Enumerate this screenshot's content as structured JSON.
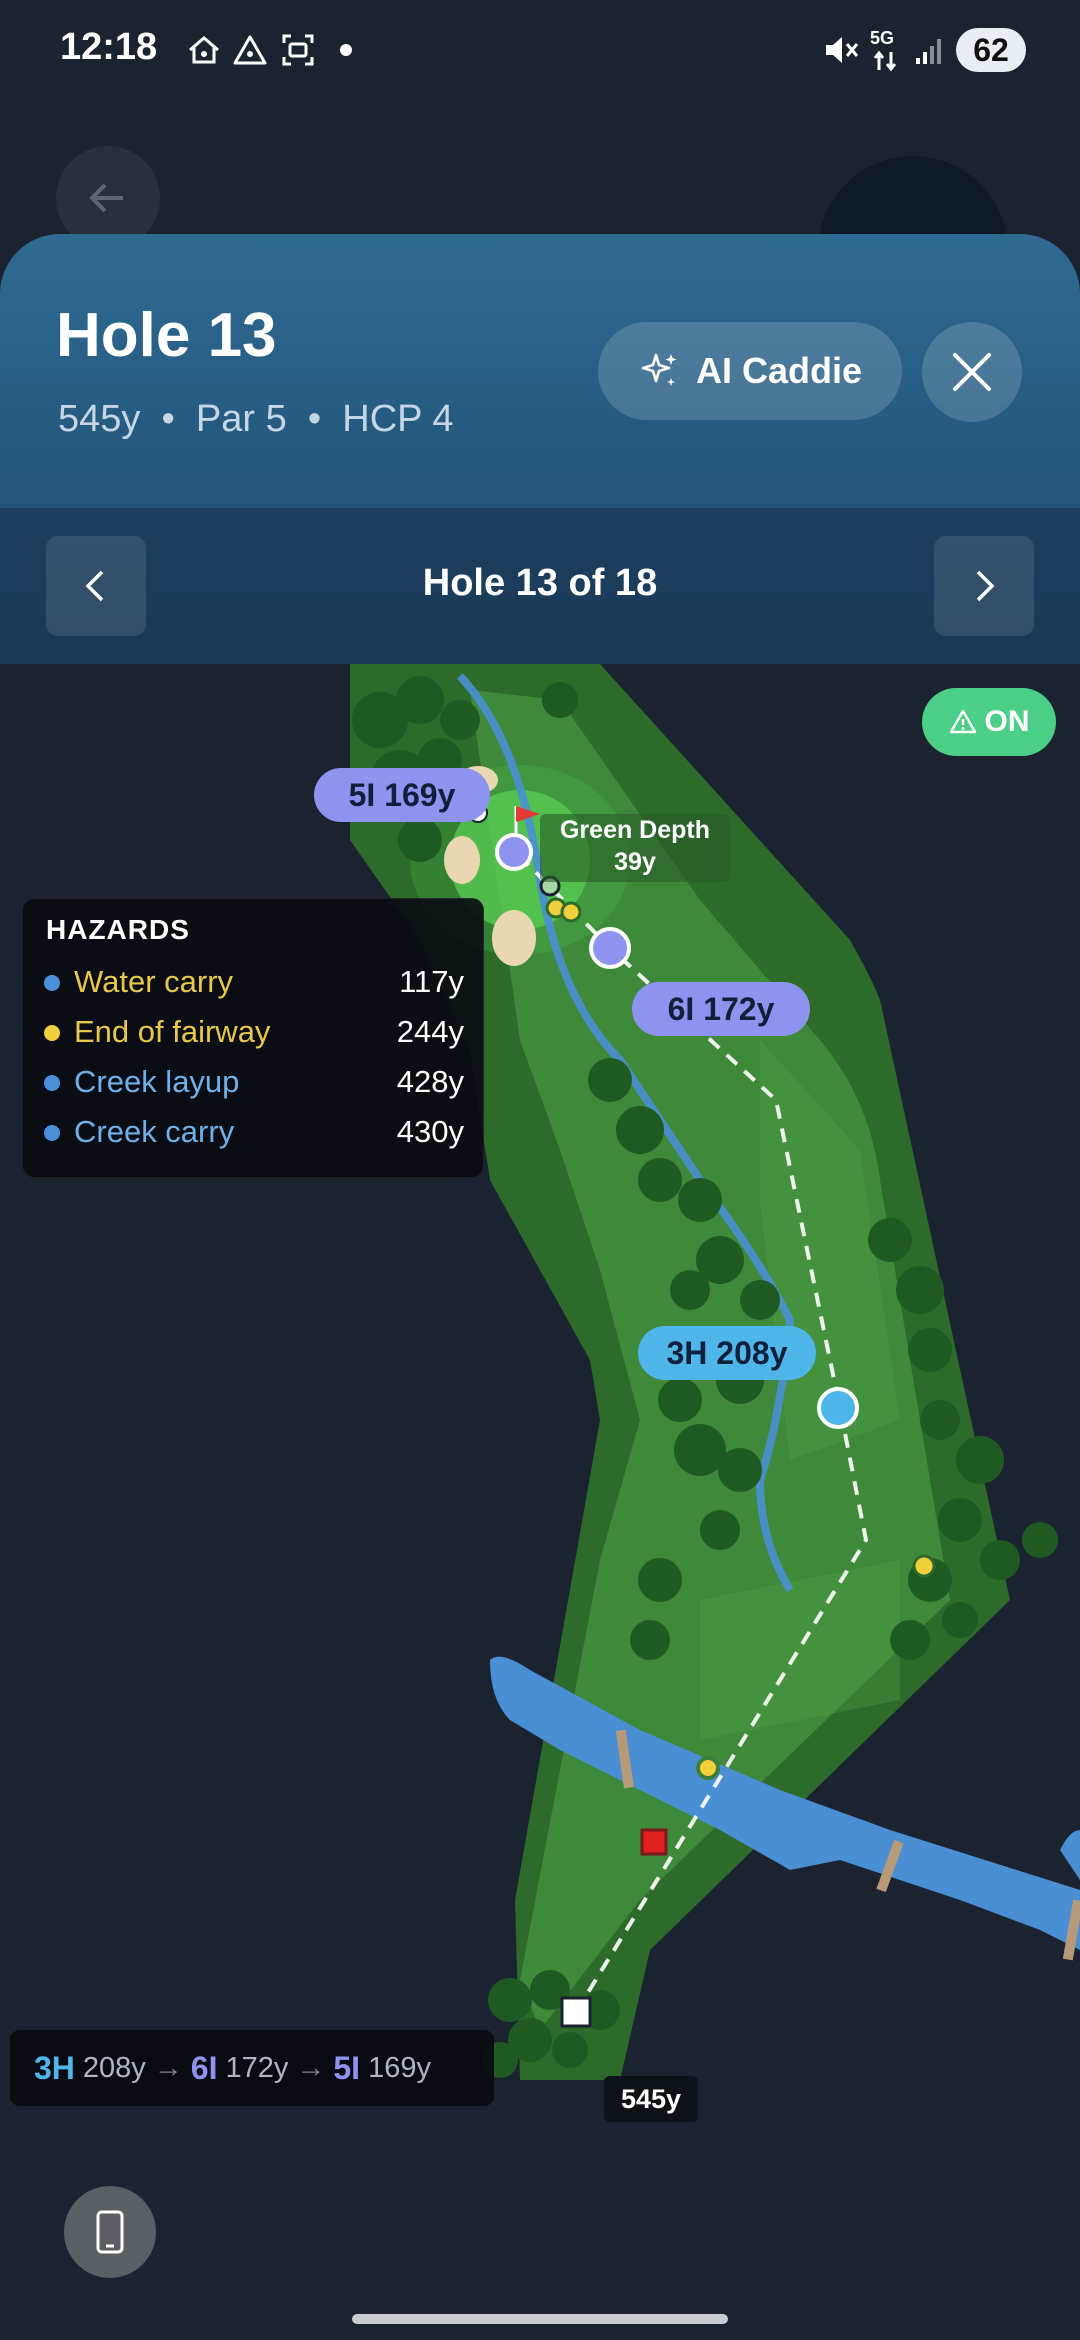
{
  "status_bar": {
    "time": "12:18",
    "network": "5G",
    "battery": "62"
  },
  "header": {
    "title": "Hole 13",
    "subtitle": "545y  •  Par 5  •  HCP 4",
    "ai_caddie_label": "AI Caddie"
  },
  "nav": {
    "title": "Hole 13 of 18"
  },
  "map": {
    "toggle_label": "ON",
    "green_depth_label": "Green Depth",
    "green_depth_value": "39y",
    "club_labels": {
      "five_iron": "5I 169y",
      "six_iron": "6I 172y",
      "three_hybrid": "3H 208y"
    },
    "total_distance": "545y",
    "colors": {
      "water": "#4a8fd4",
      "fairway": "#3f8a3a",
      "rough": "#2d6b2b",
      "shot_5i": "#8f93f0",
      "shot_6i": "#8f93f0",
      "shot_3h": "#4fb6ea"
    }
  },
  "hazards": {
    "title": "HAZARDS",
    "items": [
      {
        "label": "Water carry",
        "distance": "117y",
        "color": "#4a90d9"
      },
      {
        "label": "End of fairway",
        "distance": "244y",
        "color": "#f2d03b"
      },
      {
        "label": "Creek layup",
        "distance": "428y",
        "color": "#4a90d9"
      },
      {
        "label": "Creek carry",
        "distance": "430y",
        "color": "#4a90d9"
      }
    ]
  },
  "summary": {
    "shot1_club": "3H",
    "shot1_dist": "208y",
    "shot2_club": "6I",
    "shot2_dist": "172y",
    "shot3_club": "5I",
    "shot3_dist": "169y",
    "arrow": "→"
  }
}
